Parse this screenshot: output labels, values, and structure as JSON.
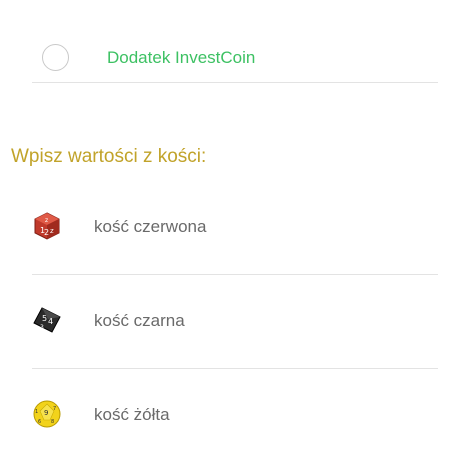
{
  "addon": {
    "label": "Dodatek InvestCoin",
    "selected": false
  },
  "section_title": "Wpisz wartości z kości:",
  "dice": [
    {
      "label": "kość czerwona",
      "icon": "red-die-icon",
      "color": "#c0392b"
    },
    {
      "label": "kość czarna",
      "icon": "black-die-icon",
      "color": "#2a2a2a"
    },
    {
      "label": "kość żółta",
      "icon": "yellow-die-icon",
      "color": "#f2d31b"
    }
  ],
  "colors": {
    "accent_green": "#3dc163",
    "title_gold": "#c1a32a",
    "label_gray": "#6a6a6a",
    "divider": "#e3e3e3"
  }
}
